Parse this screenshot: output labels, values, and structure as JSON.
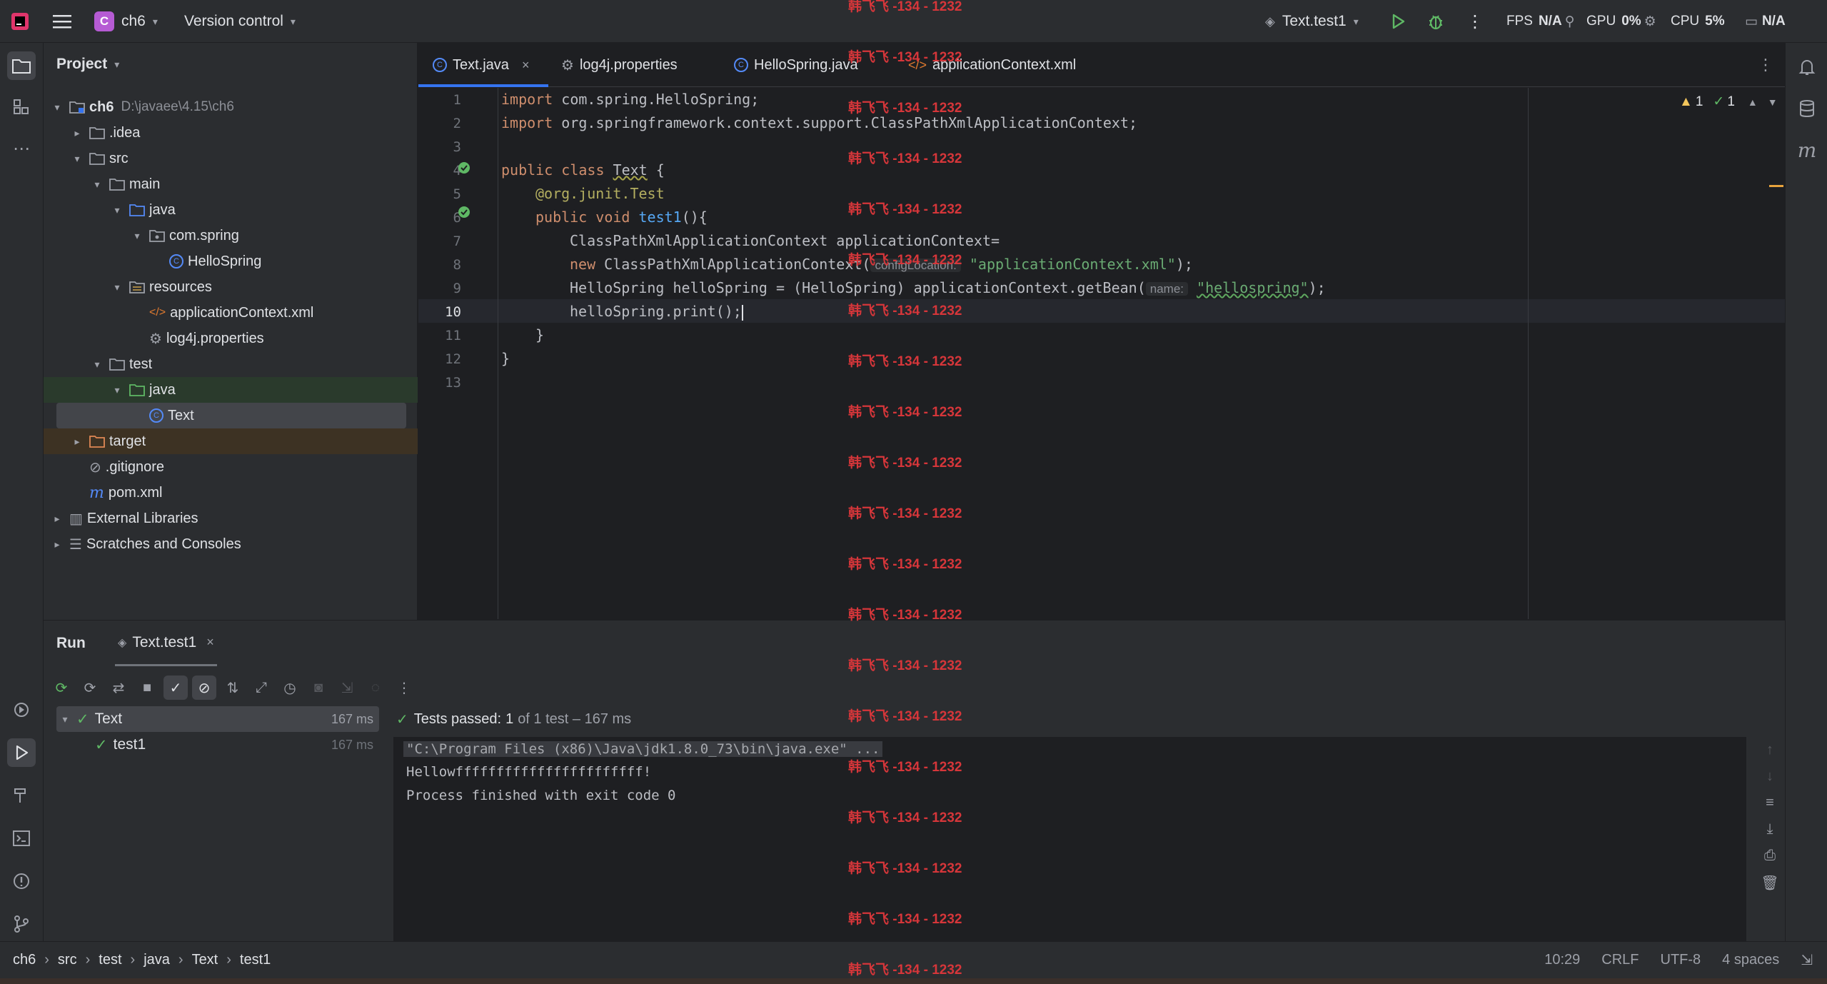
{
  "titlebar": {
    "project_badge": "C",
    "project_name": "ch6",
    "vcs_label": "Version control",
    "run_config": "Text.test1",
    "fps_label": "FPS",
    "fps_value": "N/A",
    "gpu_label": "GPU",
    "gpu_value": "0%",
    "cpu_label": "CPU",
    "cpu_value": "5%",
    "other_value": "N/A"
  },
  "project": {
    "title": "Project",
    "tree": [
      {
        "label": "ch6",
        "path": "D:\\javaee\\4.15\\ch6",
        "depth": 0,
        "arrow": "open",
        "icon": "module-folder-icon"
      },
      {
        "label": ".idea",
        "depth": 1,
        "arrow": "closed",
        "icon": "folder-icon"
      },
      {
        "label": "src",
        "depth": 1,
        "arrow": "open",
        "icon": "folder-icon"
      },
      {
        "label": "main",
        "depth": 2,
        "arrow": "open",
        "icon": "folder-icon"
      },
      {
        "label": "java",
        "depth": 3,
        "arrow": "open",
        "icon": "source-folder-icon"
      },
      {
        "label": "com.spring",
        "depth": 4,
        "arrow": "open",
        "icon": "package-icon"
      },
      {
        "label": "HelloSpring",
        "depth": 5,
        "arrow": "none",
        "icon": "class-icon"
      },
      {
        "label": "resources",
        "depth": 3,
        "arrow": "open",
        "icon": "resources-folder-icon"
      },
      {
        "label": "applicationContext.xml",
        "depth": 4,
        "arrow": "none",
        "icon": "xml-file-icon"
      },
      {
        "label": "log4j.properties",
        "depth": 4,
        "arrow": "none",
        "icon": "properties-file-icon"
      },
      {
        "label": "test",
        "depth": 2,
        "arrow": "open",
        "icon": "folder-icon"
      },
      {
        "label": "java",
        "depth": 3,
        "arrow": "open",
        "icon": "test-folder-icon"
      },
      {
        "label": "Text",
        "depth": 4,
        "arrow": "none",
        "icon": "class-icon"
      },
      {
        "label": "target",
        "depth": 1,
        "arrow": "closed",
        "icon": "excluded-folder-icon"
      },
      {
        "label": ".gitignore",
        "depth": 1,
        "arrow": "none",
        "icon": "gitignore-icon"
      },
      {
        "label": "pom.xml",
        "depth": 1,
        "arrow": "none",
        "icon": "maven-icon"
      },
      {
        "label": "External Libraries",
        "depth": 0,
        "arrow": "closed",
        "icon": "libraries-icon"
      },
      {
        "label": "Scratches and Consoles",
        "depth": 0,
        "arrow": "closed",
        "icon": "scratches-icon"
      }
    ]
  },
  "editor": {
    "tabs": [
      {
        "label": "Text.java",
        "active": true,
        "icon": "class-icon"
      },
      {
        "label": "log4j.properties",
        "active": false,
        "icon": "properties-file-icon"
      },
      {
        "label": "HelloSpring.java",
        "active": false,
        "icon": "class-icon"
      },
      {
        "label": "applicationContext.xml",
        "active": false,
        "icon": "xml-file-icon"
      }
    ],
    "inspection": {
      "warnings": "1",
      "ok": "1"
    },
    "line_numbers": [
      "1",
      "2",
      "3",
      "4",
      "5",
      "6",
      "7",
      "8",
      "9",
      "10",
      "11",
      "12",
      "13"
    ],
    "current_line": "10",
    "code": {
      "l1_kw": "import",
      "l1_rest": " com.spring.HelloSpring;",
      "l2_kw": "import",
      "l2_rest": " org.springframework.context.support.ClassPathXmlApplicationContext;",
      "l4_kw": "public class",
      "l4_name": "Text",
      "l4_rest": " {",
      "l5_ann": "@org.junit.Test",
      "l6_kw": "public void",
      "l6_fn": "test1",
      "l6_rest": "(){",
      "l7": "ClassPathXmlApplicationContext applicationContext=",
      "l8_kw": "new",
      "l8_mid": " ClassPathXmlApplicationContext(",
      "l8_hint": "configLocation:",
      "l8_str": "\"applicationContext.xml\"",
      "l8_end": ");",
      "l9_pre": "HelloSpring helloSpring = (HelloSpring) applicationContext.getBean(",
      "l9_hint": "name:",
      "l9_str": "\"hellospring\"",
      "l9_end": ");",
      "l10": "helloSpring.print();",
      "l11": "}",
      "l12": "}"
    }
  },
  "run": {
    "title": "Run",
    "tab_label": "Text.test1",
    "status_prefix": "Tests passed:",
    "status_count": "1",
    "status_suffix": "of 1 test – 167 ms",
    "tree": [
      {
        "label": "Text",
        "time": "167 ms"
      },
      {
        "label": "test1",
        "time": "167 ms"
      }
    ],
    "console": [
      "\"C:\\Program Files (x86)\\Java\\jdk1.8.0_73\\bin\\java.exe\" ...",
      "Hellowfffffffffffffffffffffff!",
      "Process finished with exit code 0"
    ]
  },
  "statusbar": {
    "breadcrumbs": [
      "ch6",
      "src",
      "test",
      "java",
      "Text",
      "test1"
    ],
    "position": "10:29",
    "line_sep": "CRLF",
    "encoding": "UTF-8",
    "indent": "4 spaces"
  },
  "watermark": "韩飞飞 -134 - 1232",
  "colors": {
    "accent": "#3574f0",
    "pass_green": "#5fb865",
    "watermark_red": "#d6363a"
  }
}
